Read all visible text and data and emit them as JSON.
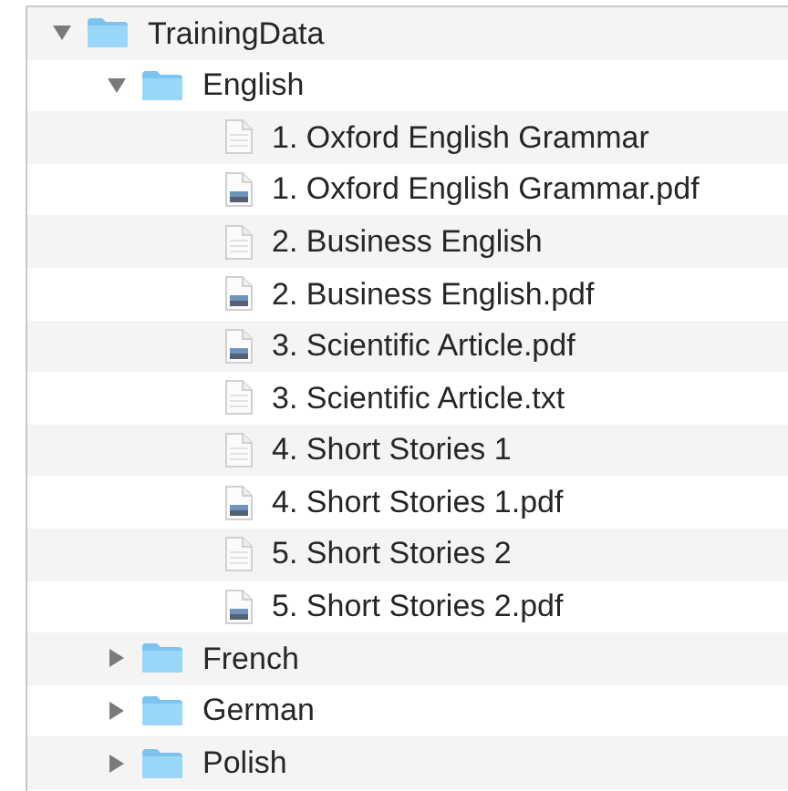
{
  "tree": [
    {
      "kind": "folder",
      "name": "TrainingData",
      "expanded": true,
      "children": [
        {
          "kind": "folder",
          "name": "English",
          "expanded": true,
          "children": [
            {
              "kind": "text",
              "name": "1. Oxford English Grammar"
            },
            {
              "kind": "pdf",
              "name": "1. Oxford English Grammar.pdf"
            },
            {
              "kind": "text",
              "name": "2. Business English"
            },
            {
              "kind": "pdf",
              "name": "2. Business English.pdf"
            },
            {
              "kind": "pdf",
              "name": "3. Scientific Article.pdf"
            },
            {
              "kind": "text",
              "name": "3. Scientific Article.txt"
            },
            {
              "kind": "text",
              "name": "4. Short Stories 1"
            },
            {
              "kind": "pdf",
              "name": "4. Short Stories 1.pdf"
            },
            {
              "kind": "text",
              "name": "5. Short Stories 2"
            },
            {
              "kind": "pdf",
              "name": "5. Short Stories 2.pdf"
            }
          ]
        },
        {
          "kind": "folder",
          "name": "French",
          "expanded": false
        },
        {
          "kind": "folder",
          "name": "German",
          "expanded": false
        },
        {
          "kind": "folder",
          "name": "Polish",
          "expanded": false
        }
      ]
    }
  ]
}
